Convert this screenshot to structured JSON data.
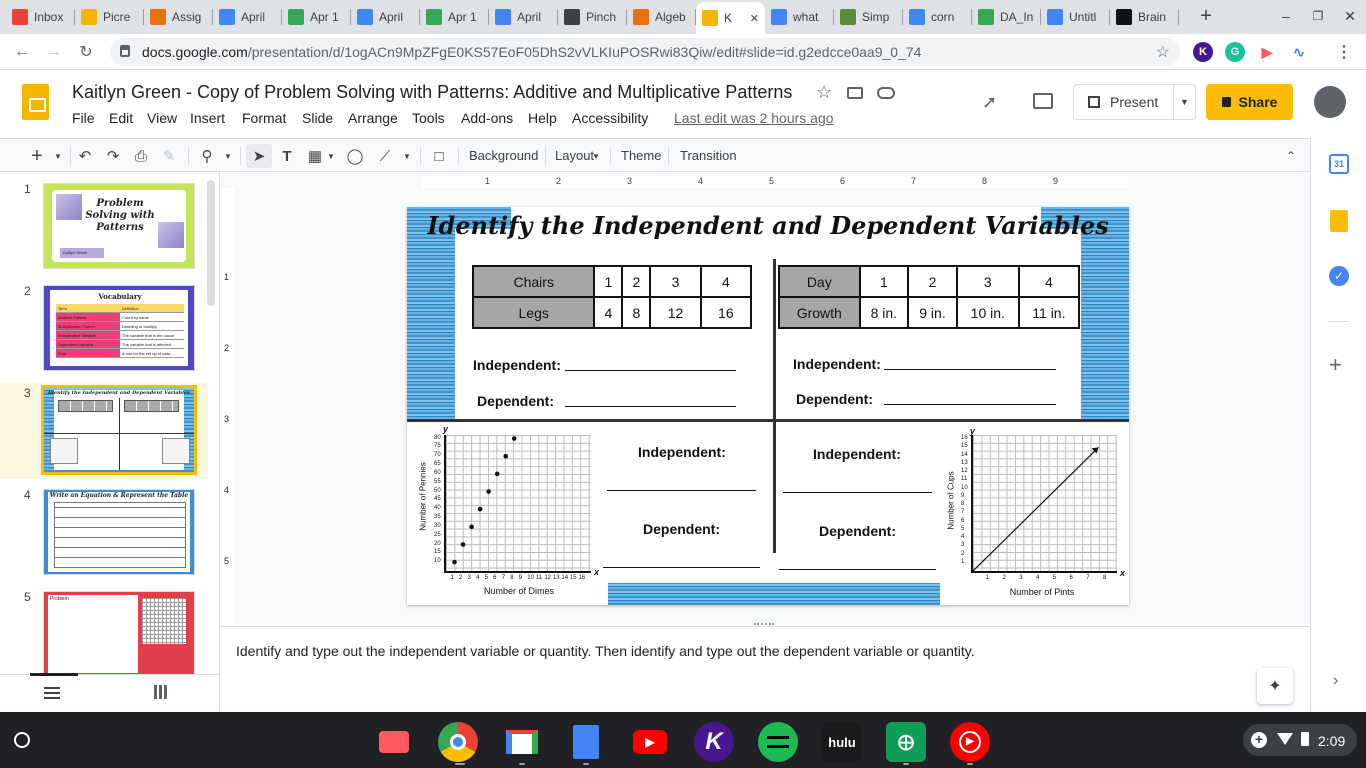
{
  "tabs": [
    {
      "label": "Inbox",
      "icon": "gmail-icon",
      "color": "#ea4335"
    },
    {
      "label": "Picre",
      "icon": "picrew-icon",
      "color": "#f4b400"
    },
    {
      "label": "Assig",
      "icon": "assignment-icon",
      "color": "#e8710a"
    },
    {
      "label": "April",
      "icon": "docs-icon",
      "color": "#4285f4"
    },
    {
      "label": "Apr 1",
      "icon": "drive-icon",
      "color": "#34a853"
    },
    {
      "label": "April",
      "icon": "docs-icon",
      "color": "#4285f4"
    },
    {
      "label": "Apr 1",
      "icon": "drive-icon",
      "color": "#34a853"
    },
    {
      "label": "April",
      "icon": "docs-icon",
      "color": "#4285f4"
    },
    {
      "label": "Pinch",
      "icon": "pinch-icon",
      "color": "#3c4043"
    },
    {
      "label": "Algeb",
      "icon": "assignment-icon",
      "color": "#e8710a"
    },
    {
      "label": "K",
      "icon": "slides-icon",
      "color": "#f4b400"
    },
    {
      "label": "what",
      "icon": "google-icon",
      "color": "#4285f4"
    },
    {
      "label": "Simp",
      "icon": "simp-icon",
      "color": "#5f8a3a"
    },
    {
      "label": "corn",
      "icon": "google-icon",
      "color": "#4285f4"
    },
    {
      "label": "DA_In",
      "icon": "drive-icon",
      "color": "#34a853"
    },
    {
      "label": "Untitl",
      "icon": "docs-icon",
      "color": "#4285f4"
    },
    {
      "label": "Brain",
      "icon": "brain-icon",
      "color": "#111111"
    }
  ],
  "url": {
    "domain": "docs.google.com",
    "path": "/presentation/d/1ogACn9MpZFgE0KS57EoF05DhS2vVLKIuPOSRwi83Qiw/edit#slide=id.g2edcce0aa9_0_74"
  },
  "doc": {
    "title": "Kaitlyn Green - Copy of Problem Solving with Patterns: Additive and Multiplicative Patterns",
    "last_edit": "Last edit was 2 hours ago",
    "present_label": "Present",
    "share_label": "Share"
  },
  "menu": [
    "File",
    "Edit",
    "View",
    "Insert",
    "Format",
    "Slide",
    "Arrange",
    "Tools",
    "Add-ons",
    "Help",
    "Accessibility"
  ],
  "toolbar": {
    "background": "Background",
    "layout": "Layout",
    "theme": "Theme",
    "transition": "Transition"
  },
  "filmstrip": {
    "slides": [
      {
        "num": "1",
        "title": "Problem Solving with Patterns",
        "caption": "Kaitlyn Green"
      },
      {
        "num": "2",
        "title": "Vocabulary",
        "rows": [
          "Term",
          "Additive Pattern",
          "Multiplicative Pattern",
          "Independent Variable",
          "Dependent Variable",
          "Rule"
        ],
        "defs": [
          "Definition",
          "Count by same",
          "Doubling or multiply",
          "The variable that is the cause",
          "The variable that is affected",
          "A rule for the set up of data"
        ]
      },
      {
        "num": "3",
        "title": "Identify the Independent and Dependent Variables"
      },
      {
        "num": "4",
        "title": "Write an Equation & Represent the Table"
      },
      {
        "num": "5",
        "title": "Problem"
      }
    ]
  },
  "slide": {
    "title": "Identify the Independent and Dependent Variables",
    "table_chairs": {
      "headers": [
        "Chairs",
        "1",
        "2",
        "3",
        "4"
      ],
      "values": [
        "Legs",
        "4",
        "8",
        "12",
        "16"
      ]
    },
    "table_day": {
      "headers": [
        "Day",
        "1",
        "2",
        "3",
        "4"
      ],
      "values": [
        "Growth",
        "8 in.",
        "9 in.",
        "10 in.",
        "11 in."
      ]
    },
    "independent_label": "Independent:",
    "dependent_label": "Dependent:",
    "graph_pennies": {
      "type": "scatter",
      "xlabel": "Number of Dimes",
      "ylabel": "Number of Pennies",
      "x_axis_letter": "x",
      "y_axis_letter": "y",
      "xticks": [
        "1",
        "2",
        "3",
        "4",
        "5",
        "6",
        "7",
        "8",
        "9",
        "10",
        "11",
        "12",
        "13",
        "14",
        "15",
        "16"
      ],
      "yticks": [
        "10",
        "15",
        "20",
        "25",
        "30",
        "35",
        "40",
        "45",
        "50",
        "55",
        "60",
        "65",
        "70",
        "75",
        "80"
      ],
      "x": [
        1,
        2,
        3,
        4,
        5,
        6,
        7,
        8
      ],
      "y": [
        10,
        20,
        30,
        40,
        50,
        60,
        70,
        80
      ],
      "xlim": [
        0,
        17
      ],
      "ylim": [
        5,
        82
      ]
    },
    "graph_cups": {
      "type": "line",
      "xlabel": "Number of Pints",
      "ylabel": "Number of Cups",
      "x_axis_letter": "x",
      "y_axis_letter": "y",
      "xticks": [
        "1",
        "2",
        "3",
        "4",
        "5",
        "6",
        "7",
        "8"
      ],
      "yticks": [
        "1",
        "2",
        "3",
        "4",
        "5",
        "6",
        "7",
        "8",
        "9",
        "10",
        "11",
        "12",
        "13",
        "14",
        "15",
        "16"
      ],
      "x": [
        0,
        7.5
      ],
      "y": [
        0,
        15
      ],
      "xlim": [
        0,
        8.6
      ],
      "ylim": [
        0,
        16.5
      ]
    }
  },
  "notes": "Identify and type out the independent variable or quantity. Then identify and type out the dependent variable or quantity.",
  "ruler": [
    "1",
    "2",
    "3",
    "4",
    "5",
    "6",
    "7",
    "8",
    "9"
  ],
  "vruler": [
    "1",
    "2",
    "3",
    "4",
    "5"
  ],
  "shelf": {
    "time": "2:09",
    "apps": [
      "screencastify-icon",
      "chrome-icon",
      "gmail-icon",
      "docs-icon",
      "youtube-icon",
      "kahoot-icon",
      "spotify-icon",
      "hulu-icon",
      "sheets-icon",
      "youtube-music-icon"
    ]
  }
}
